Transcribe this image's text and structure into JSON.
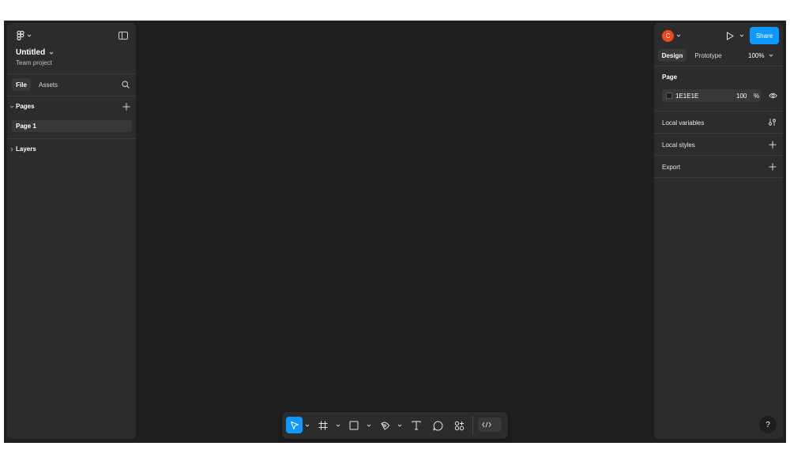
{
  "file": {
    "title": "Untitled",
    "subtitle": "Team project"
  },
  "left_tabs": [
    {
      "label": "File",
      "active": true
    },
    {
      "label": "Assets",
      "active": false
    }
  ],
  "pages_section": {
    "label": "Pages",
    "items": [
      "Page 1"
    ]
  },
  "layers_section": {
    "label": "Layers"
  },
  "header": {
    "avatar_initial": "C",
    "share_label": "Share"
  },
  "right_tabs": [
    {
      "label": "Design",
      "active": true
    },
    {
      "label": "Prototype",
      "active": false
    }
  ],
  "zoom": "100%",
  "page_props": {
    "title": "Page",
    "color_hex": "1E1E1E",
    "opacity": "100",
    "opacity_unit": "%"
  },
  "right_sections": [
    "Local variables",
    "Local styles",
    "Export"
  ],
  "help_label": "?",
  "colors": {
    "accent": "#0d99ff",
    "canvas": "#1e1e1e",
    "panel": "#2c2c2c",
    "avatar": "#f24822"
  },
  "toolbar_icons": [
    "move-tool-icon",
    "frame-tool-icon",
    "rectangle-tool-icon",
    "pen-tool-icon",
    "text-tool-icon",
    "comment-tool-icon",
    "actions-icon",
    "dev-mode-icon"
  ]
}
